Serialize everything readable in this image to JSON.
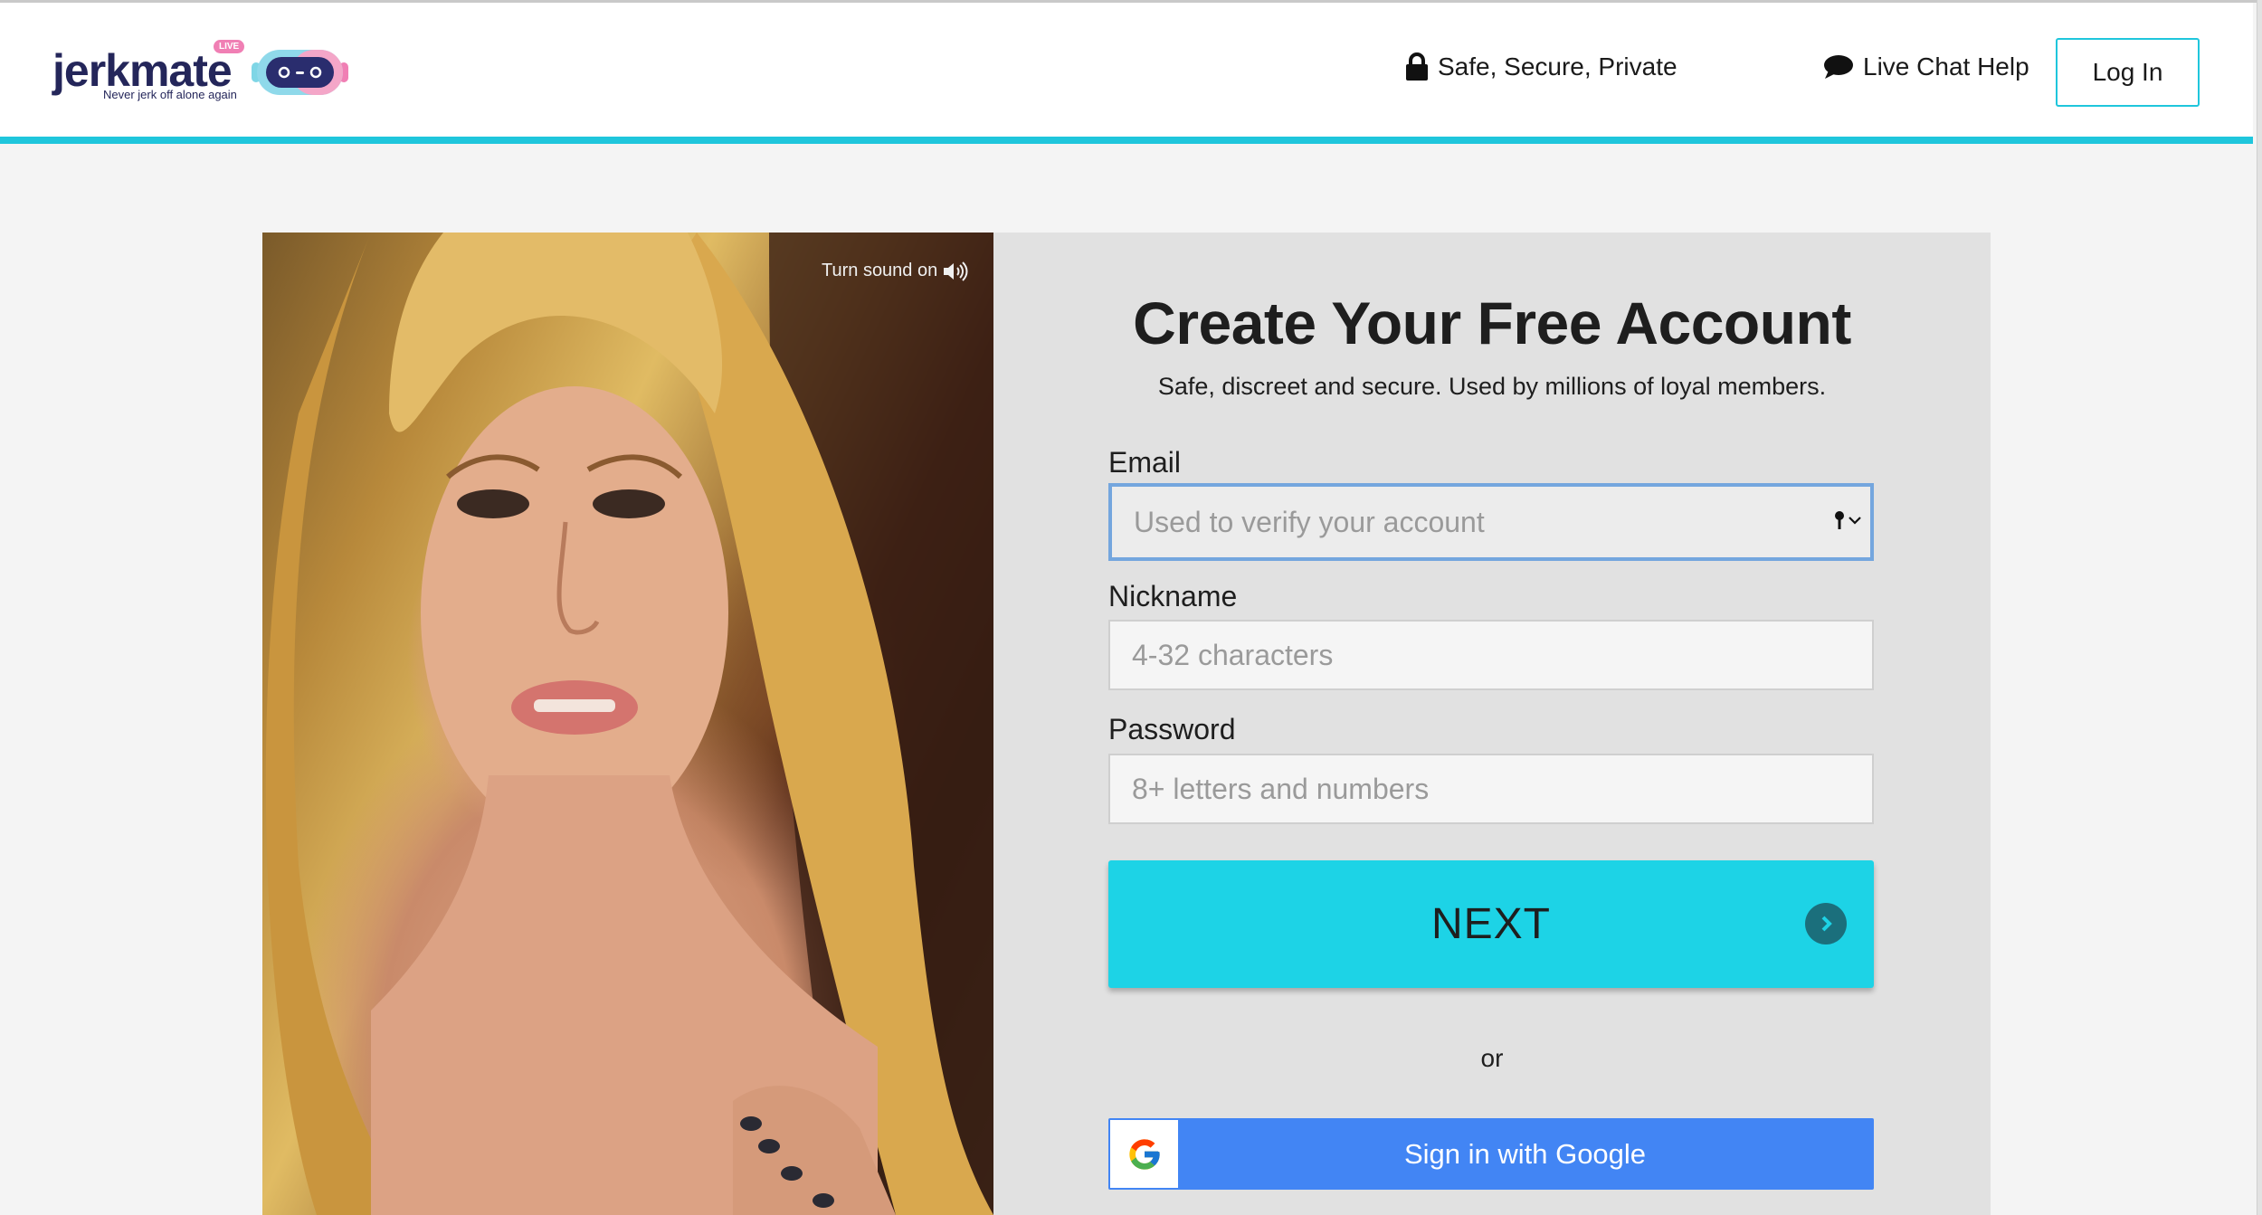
{
  "brand": {
    "name": "jerkmate",
    "badge": "LIVE",
    "tagline": "Never jerk off alone again"
  },
  "header": {
    "secure_label": "Safe, Secure, Private",
    "chat_label": "Live Chat Help",
    "login_label": "Log In"
  },
  "video": {
    "sound_label": "Turn sound on"
  },
  "form": {
    "title": "Create Your Free Account",
    "subtitle": "Safe, discreet and secure. Used by millions of loyal members.",
    "email": {
      "label": "Email",
      "placeholder": "Used to verify your account",
      "value": ""
    },
    "nickname": {
      "label": "Nickname",
      "placeholder": "4-32 characters",
      "value": ""
    },
    "password": {
      "label": "Password",
      "placeholder": "8+ letters and numbers",
      "value": ""
    },
    "next_label": "NEXT",
    "or_label": "or",
    "google_label": "Sign in with Google"
  },
  "icons": {
    "secure": "lock-icon",
    "chat": "speech-bubble-icon",
    "sound": "speaker-icon",
    "next": "chevron-right-circle-icon",
    "google": "google-g-icon",
    "password_manager": "key-icon"
  },
  "colors": {
    "accent": "#1fc6dc",
    "next_button": "#1dd3e6",
    "google_button": "#4285f4",
    "brand_navy": "#24265a",
    "brand_pink": "#f07fb4"
  }
}
